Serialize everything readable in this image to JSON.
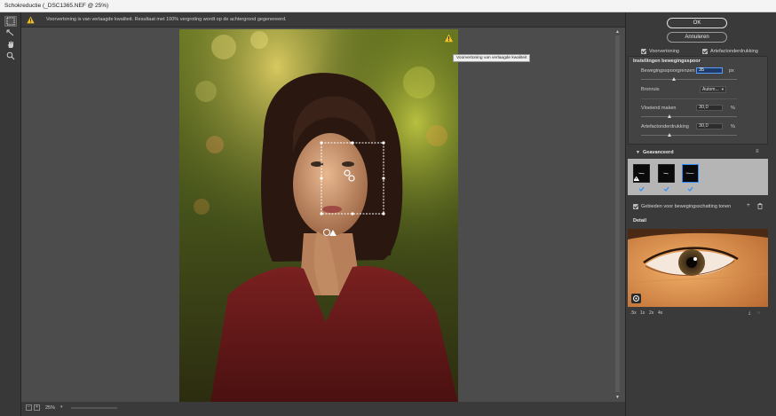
{
  "window": {
    "title": "Schokreductie (_DSC1365.NEF @ 25%)"
  },
  "notice": {
    "text": "Voorvertoning is van verlaagde kwaliteit. Resultaat met 100% vergroting wordt op de achtergrond gegenereerd.",
    "tooltip": "Voorvertoning van verlaagde kwaliteit"
  },
  "tools": [
    {
      "name": "blur-estimation-tool-icon",
      "active": true
    },
    {
      "name": "blur-direction-tool-icon",
      "active": false
    },
    {
      "name": "hand-tool-icon",
      "active": false
    },
    {
      "name": "zoom-tool-icon",
      "active": false
    }
  ],
  "status": {
    "zoom": "25%"
  },
  "buttons": {
    "ok": "OK",
    "cancel": "Annuleren"
  },
  "options": {
    "preview": {
      "label": "Voorvertoning",
      "checked": true
    },
    "artifact": {
      "label": "Artefactonderdrukking",
      "checked": true
    }
  },
  "blur_trace": {
    "title": "Instellingen bewegingsspoor",
    "bounds_label": "Bewegingsspoorgrenzen",
    "bounds_value": "35",
    "bounds_unit": "px",
    "bounds_level": 0.35,
    "source_label": "Bronruis",
    "source_value": "Autom...",
    "smoothing_label": "Vloeiend maken",
    "smoothing_value": "30,0",
    "smoothing_unit": "%",
    "smoothing_level": 0.3,
    "artifact_label": "Artefactonderdrukking",
    "artifact_value": "30,0",
    "artifact_unit": "%",
    "artifact_level": 0.3
  },
  "advanced": {
    "title": "Geavanceerd",
    "show_estimation": "Gebieden voor bewegingsschatting tonen"
  },
  "detail": {
    "title": "Detail",
    "zooms": [
      ".5x",
      "1x",
      "2x",
      "4x"
    ]
  },
  "colors": {
    "accent": "#2f8cff",
    "warning": "#f2c021",
    "panel": "#3a3a3a",
    "canvas": "#4c4c4c"
  }
}
